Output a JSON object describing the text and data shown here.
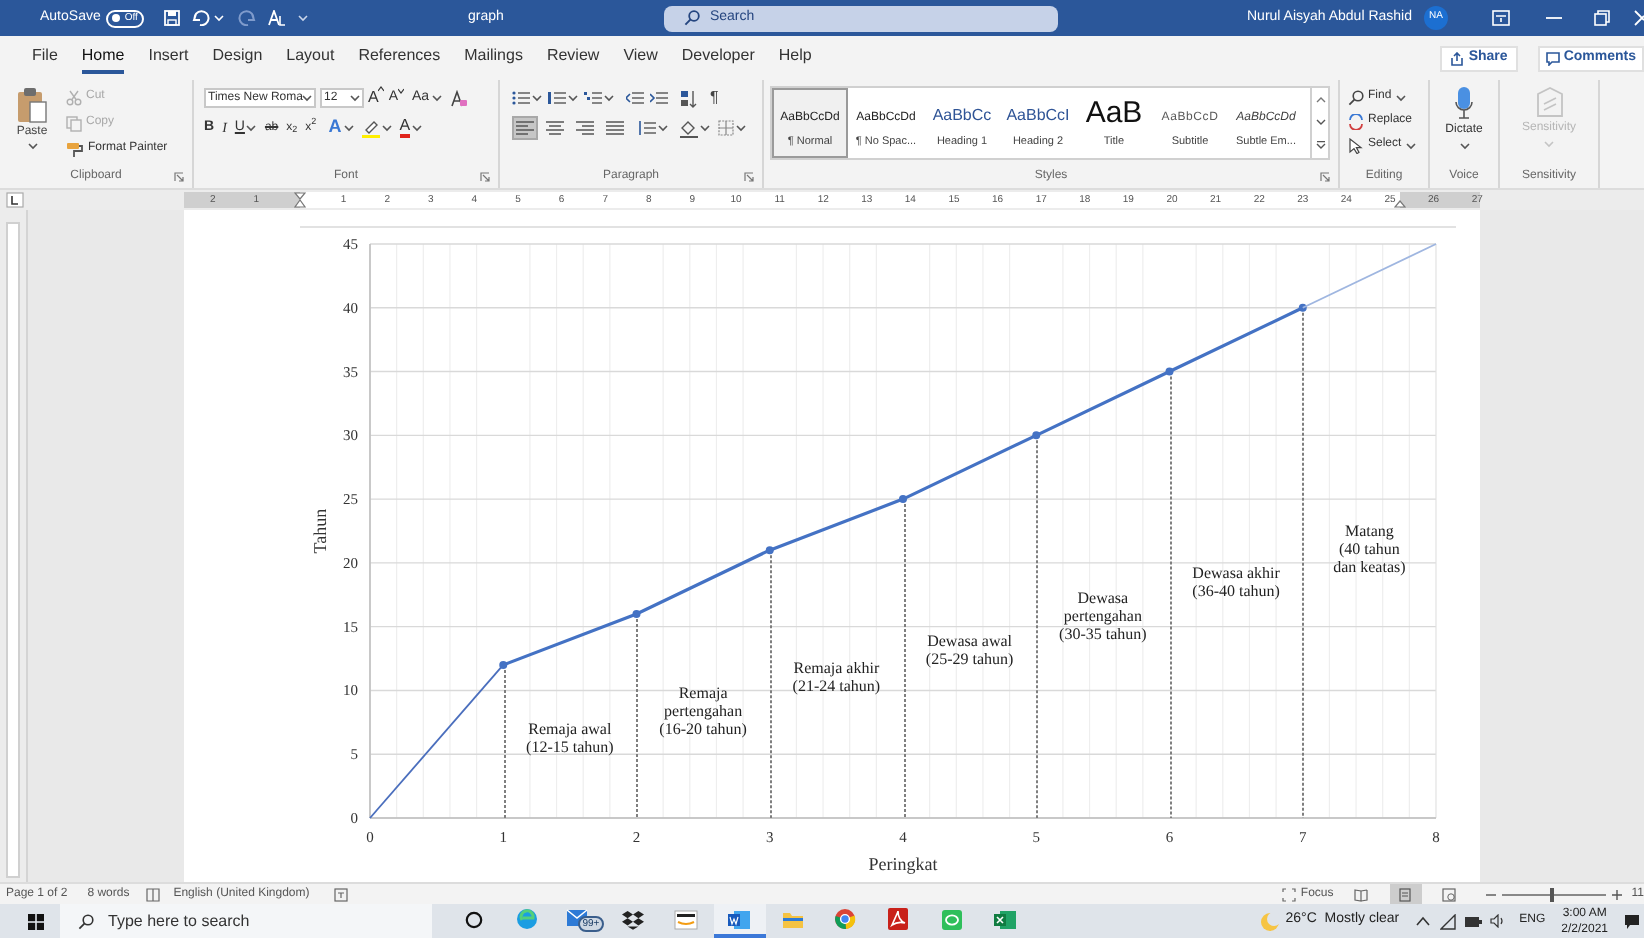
{
  "title_bar": {
    "autosave": {
      "label": "AutoSave",
      "state": "Off",
      "on": false
    },
    "document_title": "graph",
    "search": {
      "placeholder": "Search"
    },
    "user_name": "Nurul Aisyah Abdul Rashid",
    "avatar_initials": "NA"
  },
  "menu_tabs": [
    {
      "label": "File",
      "selected": false
    },
    {
      "label": "Home",
      "selected": true
    },
    {
      "label": "Insert",
      "selected": false
    },
    {
      "label": "Design",
      "selected": false
    },
    {
      "label": "Layout",
      "selected": false
    },
    {
      "label": "References",
      "selected": false
    },
    {
      "label": "Mailings",
      "selected": false
    },
    {
      "label": "Review",
      "selected": false
    },
    {
      "label": "View",
      "selected": false
    },
    {
      "label": "Developer",
      "selected": false
    },
    {
      "label": "Help",
      "selected": false
    }
  ],
  "share": "Share",
  "comments": "Comments",
  "ribbon": {
    "clipboard": {
      "label": "Clipboard",
      "paste": "Paste",
      "items": [
        {
          "label": "Cut",
          "disabled": true
        },
        {
          "label": "Copy",
          "disabled": true
        },
        {
          "label": "Format Painter",
          "disabled": false
        }
      ]
    },
    "font": {
      "label": "Font",
      "font_name": "Times New Roma",
      "font_size": "12",
      "grow": "A",
      "shrink": "A",
      "change_case": "Aa",
      "bold": "B",
      "italic": "I",
      "underline": "U",
      "strikethrough": "ab",
      "subscript": "x$_{2}$",
      "superscript": "x$^{2}$",
      "text_effects": "A",
      "font_color": "A"
    },
    "paragraph": {
      "label": "Paragraph",
      "show_marks": "¶",
      "alignments": [
        {
          "selected": true
        },
        {
          "selected": false
        },
        {
          "selected": false
        },
        {
          "selected": false
        }
      ]
    },
    "styles": {
      "label": "Styles",
      "items": [
        {
          "kind": "normal",
          "preview": "AaBbCcDd",
          "name": "¶ Normal",
          "selected": true
        },
        {
          "kind": "normal",
          "preview": "AaBbCcDd",
          "name": "¶ No Spac...",
          "selected": false
        },
        {
          "kind": "heading",
          "preview": "AaBbCc",
          "name": "Heading 1",
          "selected": false
        },
        {
          "kind": "heading",
          "preview": "AaBbCcI",
          "name": "Heading 2",
          "selected": false
        },
        {
          "kind": "title",
          "preview": "AaB",
          "name": "Title",
          "selected": false
        },
        {
          "kind": "subtitle",
          "preview": "AaBbCcD",
          "name": "Subtitle",
          "selected": false
        },
        {
          "kind": "emphasis",
          "preview": "AaBbCcDd",
          "name": "Subtle Em...",
          "selected": false
        }
      ]
    },
    "editing": {
      "label": "Editing",
      "items": [
        {
          "kind": "find",
          "label": "Find"
        },
        {
          "kind": "replace",
          "label": "Replace"
        },
        {
          "kind": "select",
          "label": "Select"
        }
      ]
    },
    "voice": {
      "label": "Voice",
      "dictate": "Dictate"
    },
    "sensitivity": {
      "label": "Sensitivity",
      "button": "Sensitivity",
      "disabled": true
    }
  },
  "ruler_numbers": [
    "2",
    "1",
    "1",
    "2",
    "3",
    "4",
    "5",
    "6",
    "7",
    "8",
    "9",
    "10",
    "11",
    "12",
    "13",
    "14",
    "15",
    "16",
    "17",
    "18",
    "19",
    "20",
    "21",
    "22",
    "23",
    "24",
    "25",
    "26",
    "27"
  ],
  "document": {
    "chart_data": {
      "type": "line",
      "xlabel": "Peringkat",
      "ylabel": "Tahun",
      "x": [
        0,
        1,
        2,
        3,
        4,
        5,
        6,
        7,
        8
      ],
      "grid": true,
      "ref_lines": [
        {
          "axis": "x",
          "value": 1
        },
        {
          "axis": "x",
          "value": 2
        },
        {
          "axis": "x",
          "value": 3
        },
        {
          "axis": "x",
          "value": 4
        },
        {
          "axis": "x",
          "value": 5
        },
        {
          "axis": "x",
          "value": 6
        },
        {
          "axis": "x",
          "value": 7
        }
      ],
      "series": [
        {
          "color": "#4a6ebd",
          "marker": false,
          "values": [
            0,
            12,
            null,
            null,
            null,
            null,
            null,
            null,
            null
          ]
        },
        {
          "color": "#4472c4",
          "marker": true,
          "values": [
            null,
            12,
            16,
            21,
            25,
            30,
            35,
            40,
            null
          ]
        },
        {
          "color": "#9fb6e0",
          "marker": false,
          "values": [
            null,
            null,
            null,
            null,
            null,
            null,
            null,
            40,
            45
          ]
        }
      ],
      "xlim": [
        0,
        8
      ],
      "ylim": [
        0,
        45
      ],
      "xticks": [
        0,
        1,
        2,
        3,
        4,
        5,
        6,
        7,
        8
      ],
      "yticks": [
        0,
        5,
        10,
        15,
        20,
        25,
        30,
        35,
        40,
        45
      ],
      "annotations": [
        {
          "text": "Remaja awal\n(12-15 tahun)"
        },
        {
          "text": "Remaja\npertengahan\n(16-20 tahun)"
        },
        {
          "text": "Remaja akhir\n(21-24 tahun)"
        },
        {
          "text": "Dewasa awal\n(25-29 tahun)"
        },
        {
          "text": "Dewasa\npertengahan\n(30-35 tahun)"
        },
        {
          "text": "Dewasa akhir\n(36-40 tahun)"
        },
        {
          "text": "Matang\n(40 tahun\ndan keatas)"
        }
      ]
    }
  },
  "status_bar": {
    "page": "Page 1 of 2",
    "words": "8 words",
    "language": "English (United Kingdom)",
    "focus": "Focus",
    "views": [
      {
        "selected": false
      },
      {
        "selected": true
      },
      {
        "selected": false
      }
    ],
    "zoom": {
      "level": 0.47
    },
    "zoom_reading": "11"
  },
  "taskbar": {
    "search": {
      "placeholder": "Type here to search"
    },
    "mail_badge": "99+",
    "apps": [
      {
        "kind": "circle",
        "active": false
      },
      {
        "kind": "browser",
        "active": false
      },
      {
        "kind": "mail",
        "active": false
      },
      {
        "kind": "box",
        "active": false
      },
      {
        "kind": "shop",
        "active": false
      },
      {
        "kind": "writer",
        "active": true
      },
      {
        "kind": "folder",
        "active": false
      },
      {
        "kind": "globe",
        "active": false
      },
      {
        "kind": "reader",
        "active": false
      },
      {
        "kind": "chat",
        "active": false
      },
      {
        "kind": "sheet",
        "active": false
      }
    ],
    "weather": "26°C  Mostly clear",
    "language": "ENG",
    "time": "3:00 AM",
    "date": "2/2/2021"
  }
}
